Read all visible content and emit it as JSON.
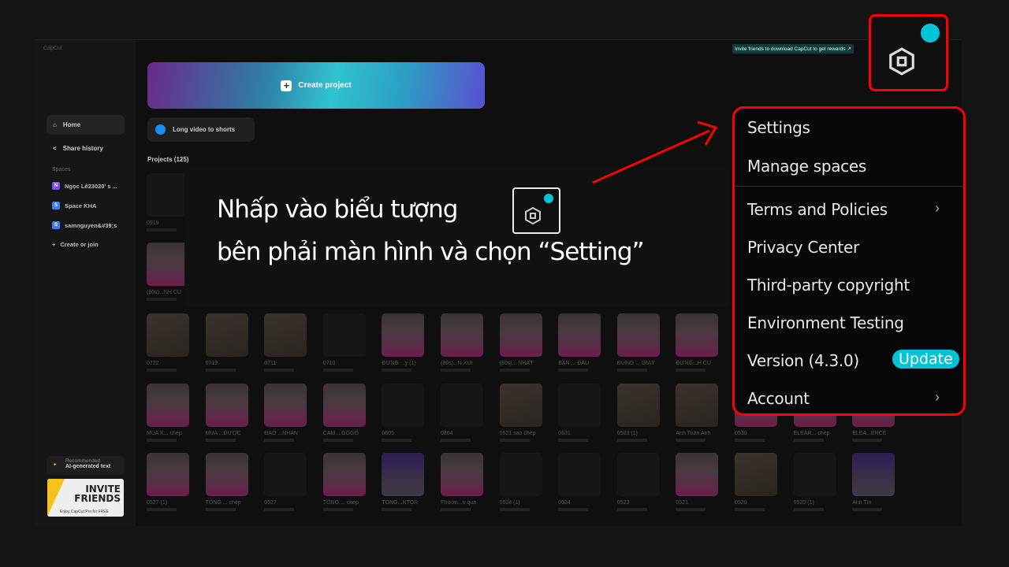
{
  "app": {
    "logo": "CapCut",
    "invite_banner": "Invite friends to download CapCut to get rewards ↗"
  },
  "sidebar": {
    "items": [
      {
        "label": "Home",
        "icon": "home-icon"
      },
      {
        "label": "Share history",
        "icon": "share-icon"
      }
    ],
    "spaces_header": "Spaces",
    "spaces": [
      {
        "badge": "N",
        "label": "Ngọc Lê23020' s ...",
        "color": "#7b4ff0"
      },
      {
        "badge": "S",
        "label": "Space KHA",
        "color": "#3f7ef0"
      },
      {
        "badge": "S",
        "label": "samnguyen&#39;s",
        "color": "#3f7ef0"
      }
    ],
    "create_join": "Create or join",
    "recommended": {
      "label": "Recommended",
      "title": "AI-generated text"
    },
    "invite_card": {
      "title1": "INVITE",
      "title2": "FRIENDS",
      "subtitle": "Enjoy CapCut Pro for FREE"
    }
  },
  "main": {
    "create_project": "Create project",
    "long_video": "Long video to shorts",
    "projects_label": "Projects  (125)",
    "rows": [
      [
        {
          "t": "0919",
          "k": "dark"
        }
      ],
      [
        {
          "t": "(80s)...NH CŨ",
          "k": "pink"
        }
      ],
      [
        {
          "t": "0722",
          "k": "photo"
        },
        {
          "t": "0719",
          "k": "photo"
        },
        {
          "t": "0711",
          "k": "photo"
        },
        {
          "t": "0710",
          "k": "dark"
        },
        {
          "t": "ĐỪNG ...y (1)",
          "k": "pink"
        },
        {
          "t": "(80s)...N XUI",
          "k": "pink"
        },
        {
          "t": "(80s)... NHẤT",
          "k": "pink"
        },
        {
          "t": "BẠN ... ĐẦU",
          "k": "pink"
        },
        {
          "t": "ĐỪNG ... GIẬT",
          "k": "pink"
        },
        {
          "t": "ĐỪNG...H CŨ",
          "k": "pink"
        }
      ],
      [
        {
          "t": "MUA K... chép",
          "k": "pink"
        },
        {
          "t": "MUA ...ĐƯỢC",
          "k": "pink"
        },
        {
          "t": "ĐẠO ...NHÂN",
          "k": "pink"
        },
        {
          "t": "CẢM ...GGGG",
          "k": "pink"
        },
        {
          "t": "0805",
          "k": "dark"
        },
        {
          "t": "0804",
          "k": "dark"
        },
        {
          "t": "0521 sao chép",
          "k": "photo"
        },
        {
          "t": "0531",
          "k": "dark"
        },
        {
          "t": "0503 (1)",
          "k": "photo"
        },
        {
          "t": "Anh Tuấn Anh",
          "k": "photo"
        },
        {
          "t": "0530",
          "k": "pink"
        },
        {
          "t": "ELEAR... chép",
          "k": "pink"
        },
        {
          "t": "ELEA...ERCE",
          "k": "pink"
        }
      ],
      [
        {
          "t": "0527 (1)",
          "k": "pink"
        },
        {
          "t": "TÔNG ... chép",
          "k": "pink"
        },
        {
          "t": "0527",
          "k": "dark"
        },
        {
          "t": "TÔNG ... chép",
          "k": "pink"
        },
        {
          "t": "TÔNG...NTOR",
          "k": "purple"
        },
        {
          "t": "Phươn...u quả",
          "k": "pink"
        },
        {
          "t": "0524 (1)",
          "k": "dark"
        },
        {
          "t": "0524",
          "k": "dark"
        },
        {
          "t": "0523",
          "k": "dark"
        },
        {
          "t": "0521",
          "k": "pink"
        },
        {
          "t": "0520",
          "k": "photo"
        },
        {
          "t": "0520 (1)",
          "k": "dark"
        },
        {
          "t": "Anh Tín",
          "k": "purple"
        }
      ]
    ]
  },
  "annotation": {
    "line1": "Nhấp vào biểu tượng",
    "line2": "bên phải màn hình và chọn “Setting”",
    "highlight_color": "#ff0000"
  },
  "menu": {
    "items": [
      {
        "label": "Settings"
      },
      {
        "label": "Manage spaces"
      },
      {
        "label": "Terms and Policies",
        "chevron": true
      },
      {
        "label": "Privacy Center"
      },
      {
        "label": "Third-party copyright"
      },
      {
        "label": "Environment Testing"
      },
      {
        "label": "Version (4.3.0)",
        "badge": "Update"
      },
      {
        "label": "Account",
        "chevron": true
      }
    ]
  },
  "colors": {
    "accent": "#00c4d6",
    "annotation": "#ff0000"
  }
}
